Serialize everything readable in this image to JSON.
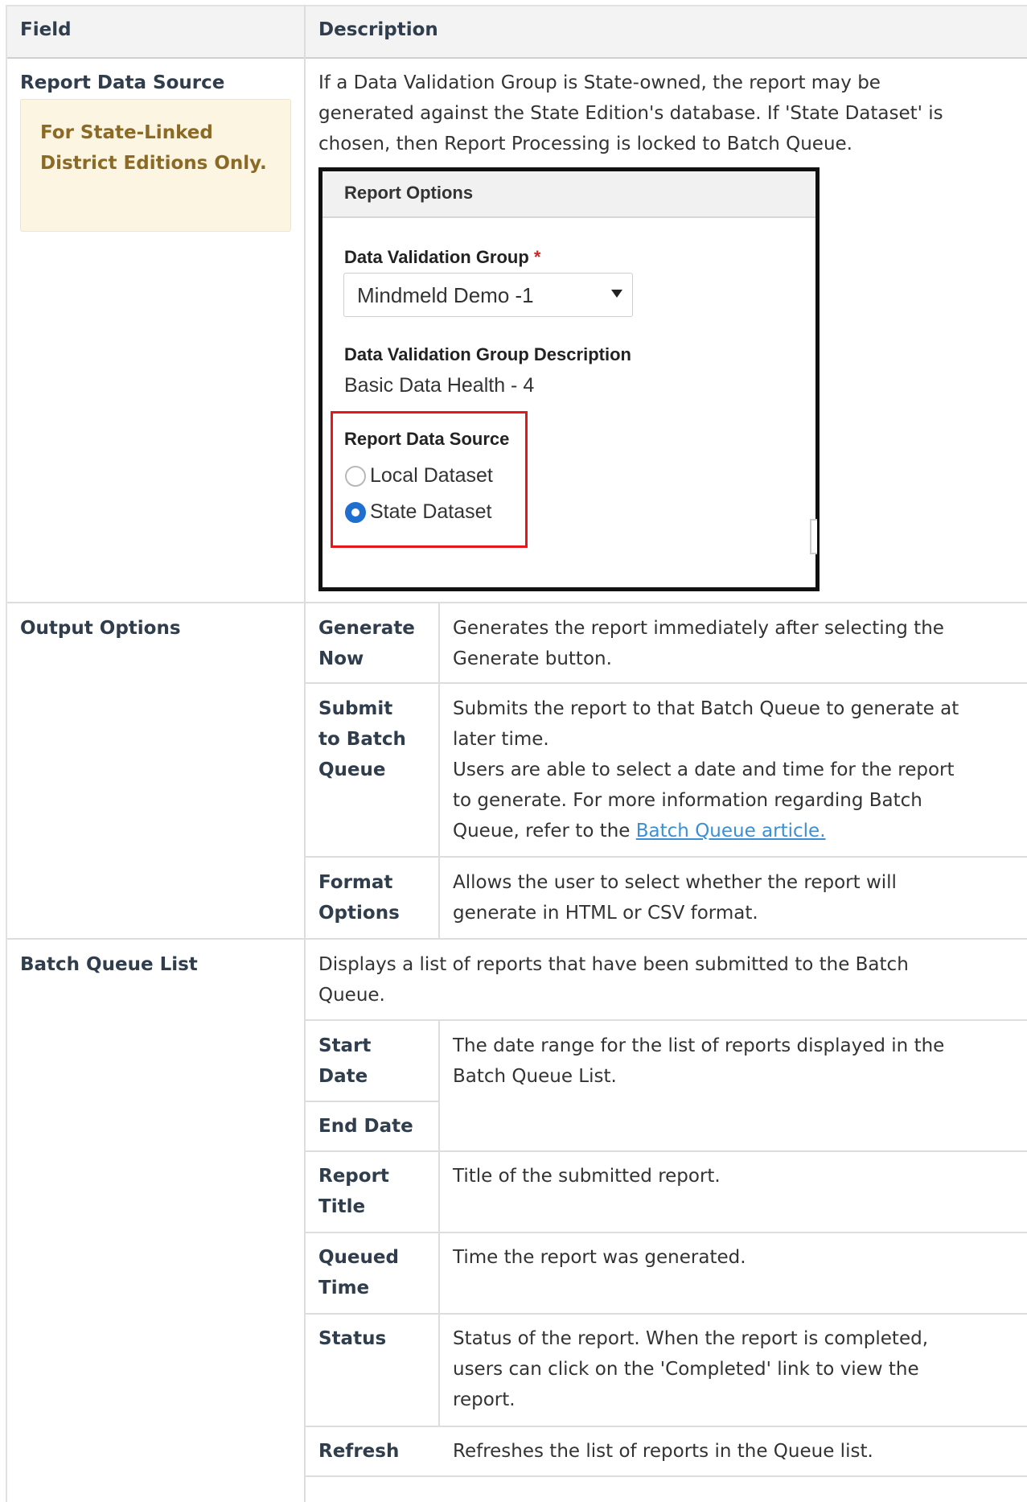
{
  "table": {
    "headers": {
      "field": "Field",
      "description": "Description"
    },
    "report_data_source": {
      "field": "Report Data Source",
      "note": "For State-Linked District Editions Only.",
      "description_lines": [
        "If a Data Validation Group is State-owned, the report may be",
        "generated against the State Edition's database. If 'State Dataset' is",
        "chosen, then Report Processing is locked to Batch Queue."
      ],
      "screenshot": {
        "title": "Report Options",
        "group_label": "Data Validation Group",
        "required_mark": "*",
        "group_value": "Mindmeld Demo -1",
        "desc_label": "Data Validation Group Description",
        "desc_value": "Basic Data Health - 4",
        "source_label": "Report Data Source",
        "options": [
          "Local Dataset",
          "State Dataset"
        ],
        "selected_option": "State Dataset"
      }
    },
    "output_options": {
      "field": "Output Options",
      "rows": [
        {
          "name_lines": [
            "Generate",
            "Now"
          ],
          "desc_lines": [
            "Generates the report immediately after selecting the",
            "Generate button."
          ]
        },
        {
          "name_lines": [
            "Submit",
            "to Batch",
            "Queue"
          ],
          "desc_lines": [
            "Submits the report to that Batch Queue to generate at",
            "later time.",
            "Users are able to select a date and time for the report",
            "to generate. For more information regarding Batch"
          ],
          "desc_last_prefix": "Queue, refer to the ",
          "link_text": "Batch Queue article."
        },
        {
          "name_lines": [
            "Format",
            "Options"
          ],
          "desc_lines": [
            "Allows the user to select whether the report will",
            "generate in HTML or CSV format."
          ]
        }
      ]
    },
    "batch_queue_list": {
      "field": "Batch Queue List",
      "intro_lines": [
        "Displays a list of reports that have been submitted to the Batch",
        "Queue."
      ],
      "rows": [
        {
          "name_lines": [
            "Start",
            "Date"
          ],
          "desc_lines": [
            "The date range for the list of reports displayed in the",
            "Batch Queue List."
          ]
        },
        {
          "name_lines": [
            "End Date"
          ],
          "desc_lines": []
        },
        {
          "name_lines": [
            "Report",
            "Title"
          ],
          "desc_lines": [
            "Title of the submitted report."
          ]
        },
        {
          "name_lines": [
            "Queued",
            "Time"
          ],
          "desc_lines": [
            "Time the report was generated."
          ]
        },
        {
          "name_lines": [
            "Status"
          ],
          "desc_lines": [
            "Status of the report. When the report is completed,",
            "users can click on the 'Completed' link to view the",
            "report."
          ]
        },
        {
          "name_lines": [
            "Refresh"
          ],
          "desc_lines": [
            "Refreshes the list of reports in the Queue list."
          ]
        }
      ]
    }
  }
}
